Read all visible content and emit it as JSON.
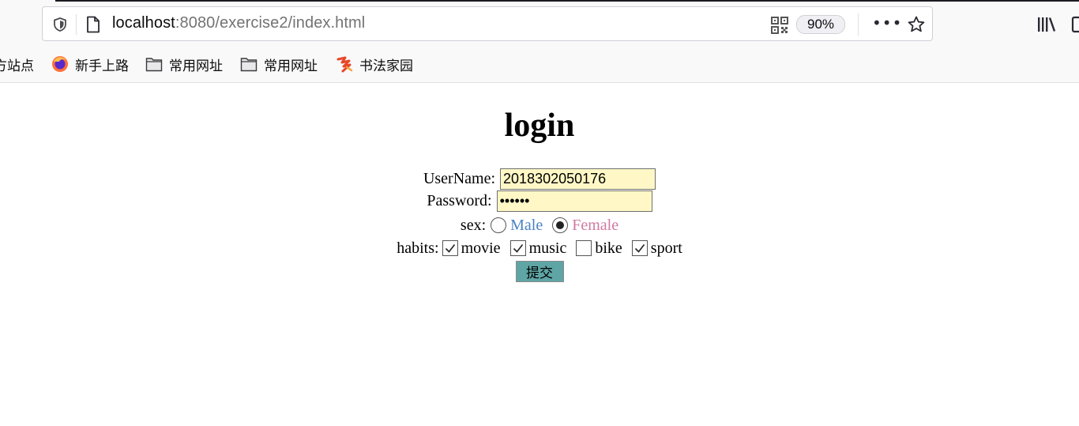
{
  "browser": {
    "url_host": "localhost",
    "url_path": ":8080/exercise2/index.html",
    "zoom": "90%",
    "bookmarks": [
      {
        "label": "方站点",
        "icon": "none"
      },
      {
        "label": "新手上路",
        "icon": "firefox-icon"
      },
      {
        "label": "常用网址",
        "icon": "folder-icon"
      },
      {
        "label": "常用网址",
        "icon": "folder-icon"
      },
      {
        "label": "书法家园",
        "icon": "calligraphy-icon"
      }
    ]
  },
  "form": {
    "title": "login",
    "username_label": "UserName:",
    "username_value": "2018302050176",
    "password_label": "Password:",
    "password_value": "123456",
    "sex_label": "sex:",
    "sex_options": [
      {
        "label": "Male",
        "checked": false,
        "color": "#4a82c4"
      },
      {
        "label": "Female",
        "checked": true,
        "color": "#d07aa1"
      }
    ],
    "habits_label": "habits:",
    "habits": [
      {
        "label": "movie",
        "checked": true
      },
      {
        "label": "music",
        "checked": true
      },
      {
        "label": "bike",
        "checked": false
      },
      {
        "label": "sport",
        "checked": true
      }
    ],
    "submit_label": "提交"
  }
}
